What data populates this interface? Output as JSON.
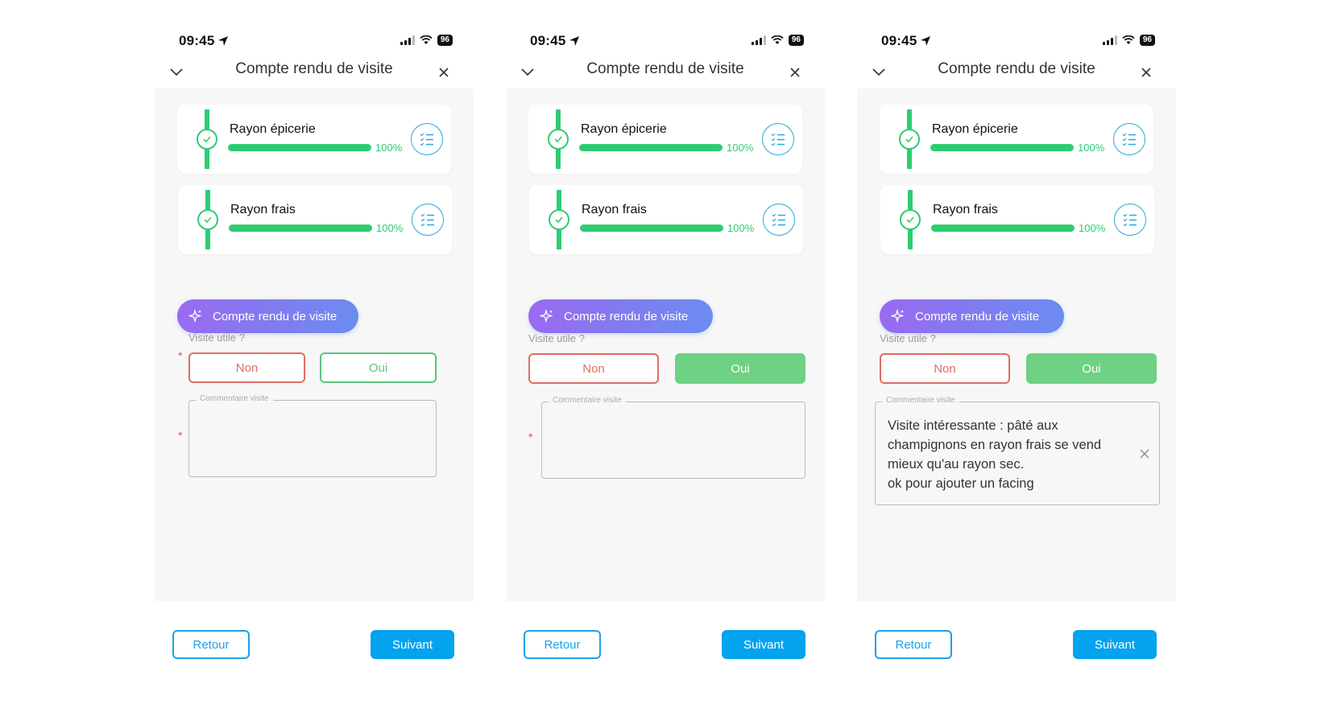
{
  "colors": {
    "green": "#2ecc71",
    "blue": "#03a3ee",
    "red": "#e06d63",
    "gradient_start": "#9a6af0",
    "gradient_end": "#6b8cf0"
  },
  "screens": [
    {
      "status": {
        "time": "09:45",
        "battery": "96"
      },
      "header": {
        "title": "Compte rendu de visite"
      },
      "sections": [
        {
          "label": "Rayon épicerie",
          "progress": 1.0,
          "percent": "100%"
        },
        {
          "label": "Rayon frais",
          "progress": 1.0,
          "percent": "100%"
        }
      ],
      "ai_button": "Compte rendu de visite",
      "question": "Visite utile ?",
      "required_mark": "*",
      "choices": {
        "no": "Non",
        "yes": "Oui",
        "selected": ""
      },
      "comment": {
        "legend": "Commentaire visite",
        "value": ""
      },
      "footer": {
        "back": "Retour",
        "next": "Suivant"
      }
    },
    {
      "status": {
        "time": "09:45",
        "battery": "96"
      },
      "header": {
        "title": "Compte rendu de visite"
      },
      "sections": [
        {
          "label": "Rayon épicerie",
          "progress": 1.0,
          "percent": "100%"
        },
        {
          "label": "Rayon frais",
          "progress": 1.0,
          "percent": "100%"
        }
      ],
      "ai_button": "Compte rendu de visite",
      "question": "Visite utile ?",
      "required_mark": "*",
      "choices": {
        "no": "Non",
        "yes": "Oui",
        "selected": "Oui"
      },
      "comment": {
        "legend": "Commentaire visite",
        "value": ""
      },
      "footer": {
        "back": "Retour",
        "next": "Suivant"
      }
    },
    {
      "status": {
        "time": "09:45",
        "battery": "96"
      },
      "header": {
        "title": "Compte rendu de visite"
      },
      "sections": [
        {
          "label": "Rayon épicerie",
          "progress": 1.0,
          "percent": "100%"
        },
        {
          "label": "Rayon frais",
          "progress": 1.0,
          "percent": "100%"
        }
      ],
      "ai_button": "Compte rendu de visite",
      "question": "Visite utile ?",
      "required_mark": "*",
      "choices": {
        "no": "Non",
        "yes": "Oui",
        "selected": "Oui"
      },
      "comment": {
        "legend": "Commentaire visite",
        "value": "Visite intéressante : pâté aux\nchampignons en rayon frais se vend\nmieux qu'au rayon sec.\nok pour ajouter un facing"
      },
      "footer": {
        "back": "Retour",
        "next": "Suivant"
      }
    }
  ]
}
